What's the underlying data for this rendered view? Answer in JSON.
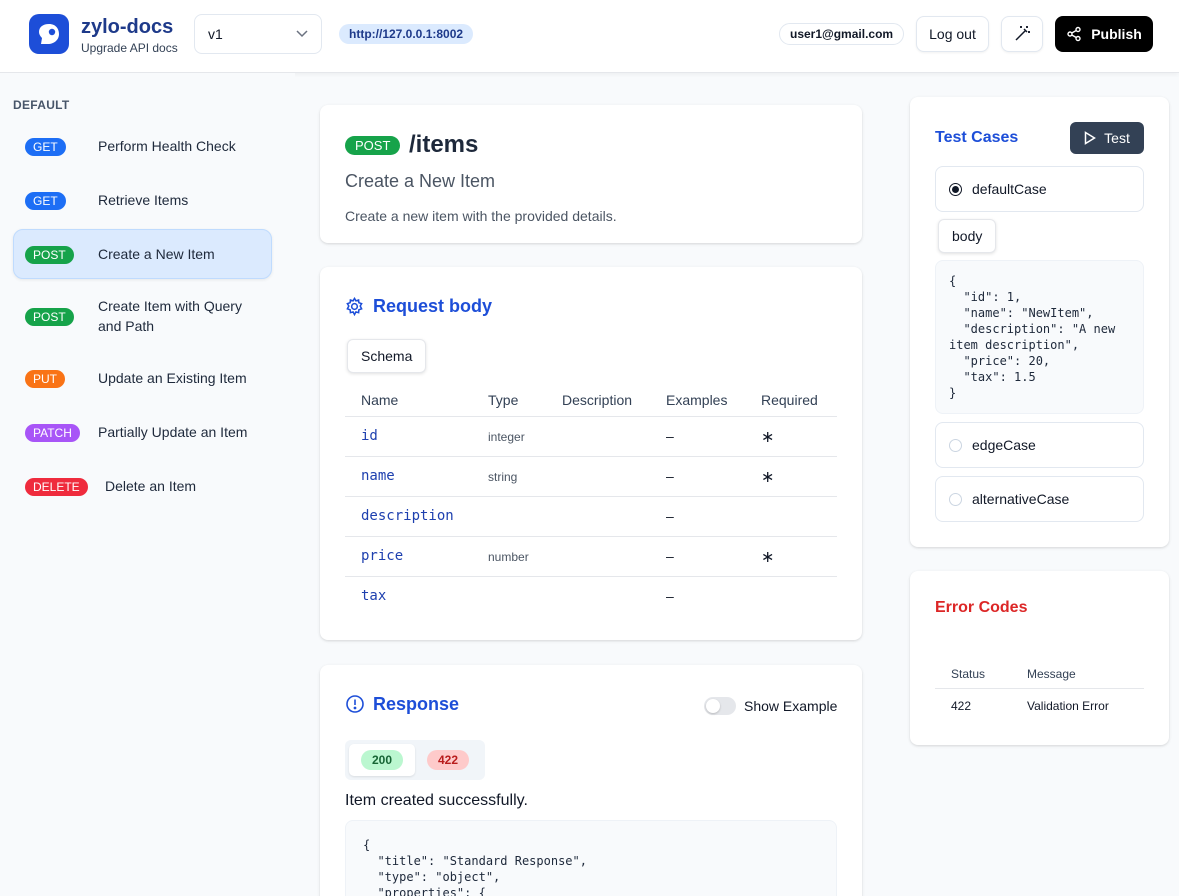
{
  "header": {
    "brand_name": "zylo-docs",
    "brand_sub": "Upgrade API docs",
    "version": "v1",
    "server_url": "http://127.0.0.1:8002",
    "user_email": "user1@gmail.com",
    "logout_label": "Log out",
    "publish_label": "Publish"
  },
  "sidebar": {
    "heading": "DEFAULT",
    "items": [
      {
        "method": "GET",
        "label": "Perform Health Check",
        "color": "#1d6ef5"
      },
      {
        "method": "GET",
        "label": "Retrieve Items",
        "color": "#1d6ef5"
      },
      {
        "method": "POST",
        "label": "Create a New Item",
        "color": "#16a34a"
      },
      {
        "method": "POST",
        "label": "Create Item with Query and Path",
        "color": "#16a34a"
      },
      {
        "method": "PUT",
        "label": "Update an Existing Item",
        "color": "#f97316"
      },
      {
        "method": "PATCH",
        "label": "Partially Update an Item",
        "color": "#a855f7"
      },
      {
        "method": "DELETE",
        "label": "Delete an Item",
        "color": "#ef2b3d"
      }
    ]
  },
  "operation": {
    "method": "POST",
    "path": "/items",
    "summary": "Create a New Item",
    "description": "Create a new item with the provided details."
  },
  "request_body": {
    "title": "Request body",
    "tab_label": "Schema",
    "columns": [
      "Name",
      "Type",
      "Description",
      "Examples",
      "Required"
    ],
    "rows": [
      {
        "name": "id",
        "type": "integer",
        "examples": "–",
        "required": "∗"
      },
      {
        "name": "name",
        "type": "string",
        "examples": "–",
        "required": "∗"
      },
      {
        "name": "description",
        "type": "",
        "examples": "–",
        "required": ""
      },
      {
        "name": "price",
        "type": "number",
        "examples": "–",
        "required": "∗"
      },
      {
        "name": "tax",
        "type": "",
        "examples": "–",
        "required": ""
      }
    ]
  },
  "response": {
    "title": "Response",
    "toggle_label": "Show Example",
    "status_codes": [
      "200",
      "422"
    ],
    "message": "Item created successfully.",
    "code": "{\n  \"title\": \"Standard Response\",\n  \"type\": \"object\",\n  \"properties\": {"
  },
  "test_cases": {
    "title": "Test Cases",
    "test_button_label": "Test",
    "cases": [
      "defaultCase",
      "edgeCase",
      "alternativeCase"
    ],
    "body_tab_label": "body",
    "body_code": "{\n  \"id\": 1,\n  \"name\": \"NewItem\",\n  \"description\": \"A new\nitem description\",\n  \"price\": 20,\n  \"tax\": 1.5\n}"
  },
  "error_codes": {
    "title": "Error Codes",
    "columns": [
      "Status",
      "Message"
    ],
    "rows": [
      {
        "status": "422",
        "message": "Validation Error"
      }
    ]
  },
  "colors": {
    "accent": "#1d4ed8",
    "error_title": "#dc2626",
    "success_pill_bg": "#bbf7d0",
    "error_pill_bg": "#fecaca"
  }
}
